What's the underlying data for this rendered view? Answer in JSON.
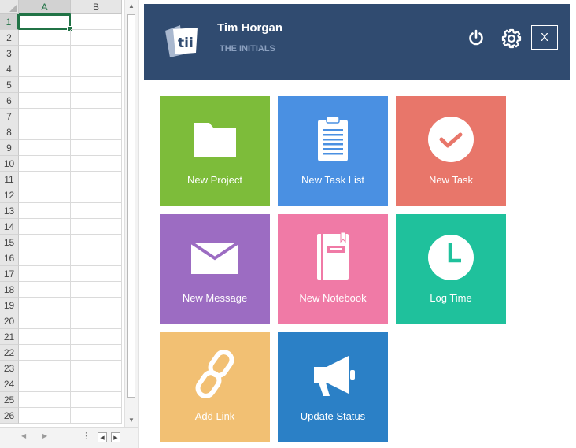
{
  "spreadsheet": {
    "columns": [
      "A",
      "B"
    ],
    "rows": [
      "1",
      "2",
      "3",
      "4",
      "5",
      "6",
      "7",
      "8",
      "9",
      "10",
      "11",
      "12",
      "13",
      "14",
      "15",
      "16",
      "17",
      "18",
      "19",
      "20",
      "21",
      "22",
      "23",
      "24",
      "25",
      "26"
    ],
    "active_cell": "A1"
  },
  "panel": {
    "user_name": "Tim Horgan",
    "org_name": "THE INITIALS",
    "close_label": "X",
    "header_color": "#304b70"
  },
  "tiles": [
    {
      "label": "New Project",
      "color": "#7dbc3a",
      "icon": "folder-icon"
    },
    {
      "label": "New Task List",
      "color": "#4a90e2",
      "icon": "clipboard-list-icon"
    },
    {
      "label": "New Task",
      "color": "#e8766a",
      "icon": "checkmark-circle-icon"
    },
    {
      "label": "New Message",
      "color": "#9c6cc2",
      "icon": "envelope-icon"
    },
    {
      "label": "New Notebook",
      "color": "#f07aa6",
      "icon": "notebook-icon"
    },
    {
      "label": "Log Time",
      "color": "#1fc19c",
      "icon": "clock-icon"
    },
    {
      "label": "Add Link",
      "color": "#f2c073",
      "icon": "chain-link-icon"
    },
    {
      "label": "Update Status",
      "color": "#2b80c6",
      "icon": "megaphone-icon"
    }
  ]
}
